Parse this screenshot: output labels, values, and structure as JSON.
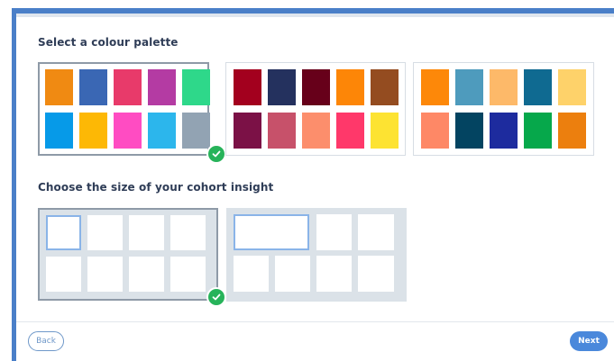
{
  "headings": {
    "palette": "Select a colour palette",
    "size": "Choose the size of your cohort insight"
  },
  "buttons": {
    "back": "Back",
    "next": "Next"
  },
  "palettes": [
    {
      "selected": true,
      "colors": [
        "#f08a12",
        "#3a67b4",
        "#e83a6a",
        "#b43ba3",
        "#2ed88a",
        "#069ae8",
        "#fdb805",
        "#ff4cc2",
        "#2cb6ec",
        "#92a3b3"
      ]
    },
    {
      "selected": false,
      "colors": [
        "#a3001e",
        "#24315e",
        "#67001a",
        "#fd8607",
        "#944c20",
        "#7b1146",
        "#c7516a",
        "#fc8e6c",
        "#ff386a",
        "#fde332"
      ]
    },
    {
      "selected": false,
      "colors": [
        "#fd8809",
        "#4e9bbd",
        "#fdb969",
        "#0f6a91",
        "#fed26a",
        "#fe8866",
        "#034461",
        "#1d2b9e",
        "#06a84b",
        "#ec7f0e"
      ]
    }
  ],
  "sizes": [
    {
      "selected": true,
      "layout": "small"
    },
    {
      "selected": false,
      "layout": "wide"
    }
  ],
  "icons": {
    "selected": "checkmark-icon"
  },
  "colors": {
    "accent": "#4a88db",
    "check": "#27b35a",
    "frame": "#4a7fc8"
  }
}
